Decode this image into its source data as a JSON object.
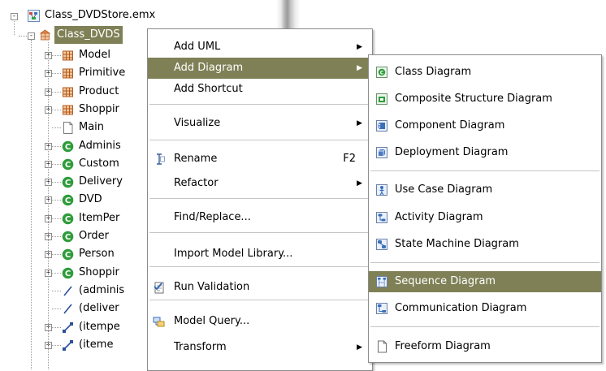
{
  "tree": {
    "root_label": "Class_DVDStore.emx",
    "package_label": "Class_DVDS",
    "children": [
      "Model",
      "Primitive",
      "Product",
      "Shoppir",
      "Main",
      "Adminis",
      "Custom",
      "Delivery",
      "DVD",
      "ItemPer",
      "Order",
      "Person",
      "Shoppir",
      "(adminis",
      "(deliver",
      "(itempe",
      "(iteme"
    ]
  },
  "context_menu": {
    "items": [
      {
        "label": "Add UML",
        "submenu": true
      },
      {
        "label": "Add Diagram",
        "submenu": true
      },
      {
        "label": "Add Shortcut"
      },
      {
        "label": "Visualize",
        "submenu": true
      },
      {
        "label": "Rename",
        "shortcut": "F2"
      },
      {
        "label": "Refactor",
        "submenu": true
      },
      {
        "label": "Find/Replace..."
      },
      {
        "label": "Import Model Library..."
      },
      {
        "label": "Run Validation"
      },
      {
        "label": "Model Query..."
      },
      {
        "label": "Transform",
        "submenu": true
      }
    ],
    "highlighted": "Add Diagram"
  },
  "diagram_submenu": {
    "items": [
      "Class Diagram",
      "Composite Structure Diagram",
      "Component Diagram",
      "Deployment Diagram",
      "Use Case Diagram",
      "Activity Diagram",
      "State Machine Diagram",
      "Sequence Diagram",
      "Communication Diagram",
      "Freeform Diagram"
    ],
    "highlighted": "Sequence Diagram"
  },
  "colors": {
    "highlight": "#7f8056",
    "class_green": "#2e9c3a",
    "package_brown": "#b25a1e"
  }
}
